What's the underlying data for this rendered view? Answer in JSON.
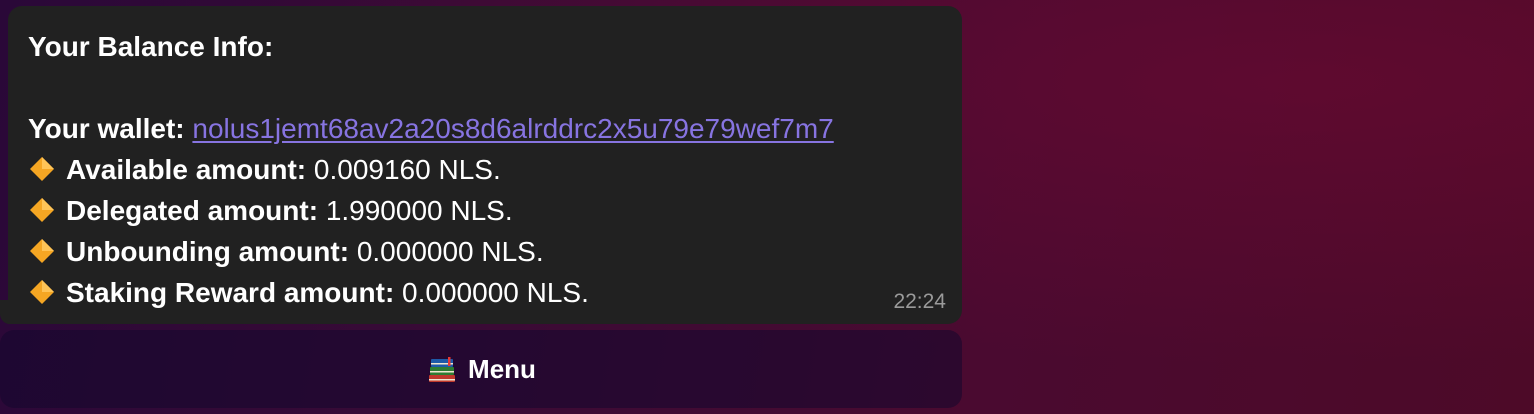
{
  "message": {
    "title": "Your Balance Info:",
    "wallet_label": "Your wallet:",
    "wallet_address": "nolus1jemt68av2a20s8d6alrddrc2x5u79e79wef7m7",
    "rows": [
      {
        "icon": "orange-diamond-icon",
        "label": "Available amount:",
        "value": "0.009160 NLS."
      },
      {
        "icon": "orange-diamond-icon",
        "label": "Delegated amount:",
        "value": "1.990000 NLS."
      },
      {
        "icon": "orange-diamond-icon",
        "label": "Unbounding amount:",
        "value": "0.000000 NLS."
      },
      {
        "icon": "orange-diamond-icon",
        "label": "Staking Reward amount:",
        "value": "0.000000 NLS."
      }
    ],
    "time": "22:24"
  },
  "keyboard": {
    "menu_icon": "books-icon",
    "menu_label": "Menu"
  },
  "colors": {
    "bubble_bg": "#212121",
    "link": "#8774e1",
    "diamond": "#f5a623"
  }
}
